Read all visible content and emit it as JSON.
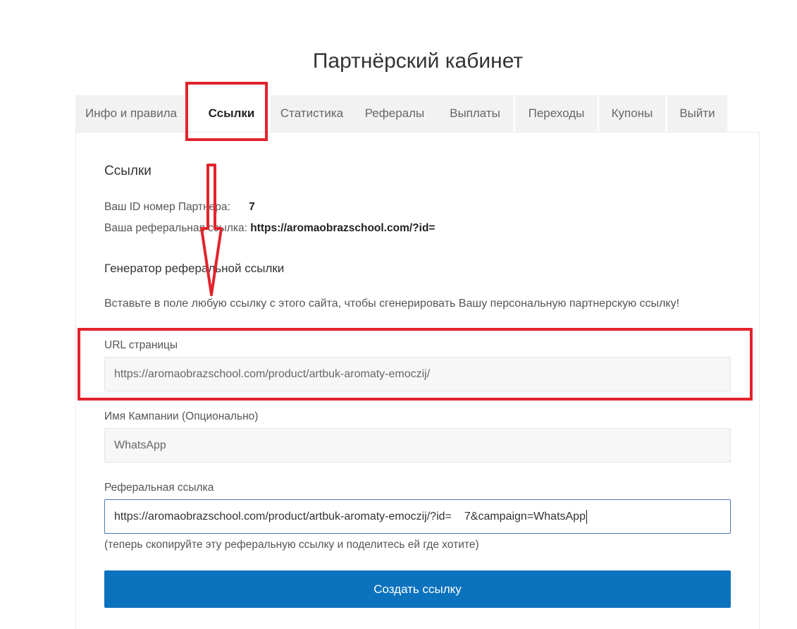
{
  "page": {
    "title": "Партнёрский кабинет"
  },
  "tabs": [
    {
      "label": "Инфо и правила",
      "active": false
    },
    {
      "label": "Ссылки",
      "active": true
    },
    {
      "label": "Статистика",
      "active": false
    },
    {
      "label": "Рефералы",
      "active": false
    },
    {
      "label": "Выплаты",
      "active": false
    },
    {
      "label": "Переходы",
      "active": false
    },
    {
      "label": "Купоны",
      "active": false
    },
    {
      "label": "Выйти",
      "active": false
    }
  ],
  "links_section": {
    "title": "Ссылки",
    "partner_id_label": "Ваш ID номер Партнера: ",
    "partner_id_value": "7",
    "referral_link_label": "Ваша реферальная ссылка: ",
    "referral_link_value": "https://aromaobrazschool.com/?id="
  },
  "generator": {
    "title": "Генератор реферальной ссылки",
    "hint": "Вставьте в поле любую ссылку с этого сайта, чтобы сгенерировать Вашу персональную партнерскую ссылку!",
    "url_label": "URL страницы",
    "url_value": "https://aromaobrazschool.com/product/artbuk-aromaty-emoczij/",
    "campaign_label": "Имя Кампании (Опционально)",
    "campaign_value": "WhatsApp",
    "ref_label": "Реферальная ссылка",
    "ref_value_part1": "https://aromaobrazschool.com/product/artbuk-aromaty-emoczij/?id=",
    "ref_value_part2": "7&campaign=WhatsApp",
    "note": "(теперь скопируйте эту реферальную ссылку и поделитесь ей где хотите)",
    "button_label": "Создать ссылку"
  },
  "colors": {
    "annotation": "#e3232c",
    "button": "#0b72be",
    "focus_border": "#4a78b8"
  }
}
